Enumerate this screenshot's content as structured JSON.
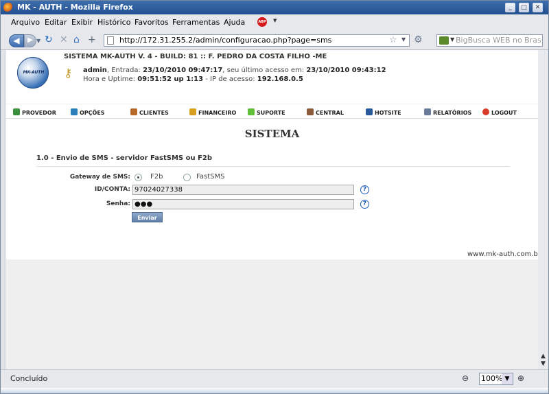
{
  "window": {
    "title": "MK - AUTH - Mozilla Firefox"
  },
  "menubar": [
    "Arquivo",
    "Editar",
    "Exibir",
    "Histórico",
    "Favoritos",
    "Ferramentas",
    "Ajuda"
  ],
  "addon": {
    "abp_label": "ABP"
  },
  "navigation": {
    "url": "http://172.31.255.2/admin/configuracao.php?page=sms",
    "search_placeholder": "BigBusca WEB no Brasil"
  },
  "header": {
    "logo_text": "MK-AUTH",
    "system_line": "SISTEMA MK-AUTH V. 4 - BUILD: 81 :: F. PEDRO DA COSTA FILHO -ME",
    "user": "admin",
    "entry_label": ", Entrada:",
    "entry_time": "23/10/2010 09:47:17",
    "last_access_label": ", seu último acesso em:",
    "last_access_time": "23/10/2010 09:43:12",
    "uptime_label": "Hora e Uptime:",
    "uptime_value": "09:51:52 up 1:13",
    "ip_label": "- IP de acesso:",
    "ip_value": "192.168.0.5"
  },
  "topmenu": [
    {
      "label": "PROVEDOR",
      "icon": "provider-icon",
      "color": "#3a8f3a"
    },
    {
      "label": "OPÇÕES",
      "icon": "options-icon",
      "color": "#2a7fb8"
    },
    {
      "label": "CLIENTES",
      "icon": "clients-icon",
      "color": "#b86a2a"
    },
    {
      "label": "FINANCEIRO",
      "icon": "finance-icon",
      "color": "#d8a020"
    },
    {
      "label": "SUPORTE",
      "icon": "support-icon",
      "color": "#5fbf3a"
    },
    {
      "label": "CENTRAL",
      "icon": "central-icon",
      "color": "#8a5a3a"
    },
    {
      "label": "HOTSITE",
      "icon": "hotsite-icon",
      "color": "#2a5a9a"
    },
    {
      "label": "RELATÓRIOS",
      "icon": "reports-icon",
      "color": "#6a7a9a"
    },
    {
      "label": "LOGOUT",
      "icon": "logout-icon",
      "color": "#d83a2a"
    }
  ],
  "page": {
    "title": "SISTEMA",
    "section": "1.0 - Envio de SMS - servidor FastSMS ou F2b"
  },
  "form": {
    "gateway_label": "Gateway de SMS:",
    "gateway_options": [
      "F2b",
      "FastSMS"
    ],
    "gateway_selected": "F2b",
    "id_label": "ID/CONTA:",
    "id_value": "97024027338",
    "password_label": "Senha:",
    "password_value": "●●●",
    "help_glyph": "?",
    "submit_label": "Enviar"
  },
  "footer": {
    "text": "www.mk-auth.com.br"
  },
  "status": {
    "text": "Concluído",
    "zoom": "100%"
  }
}
